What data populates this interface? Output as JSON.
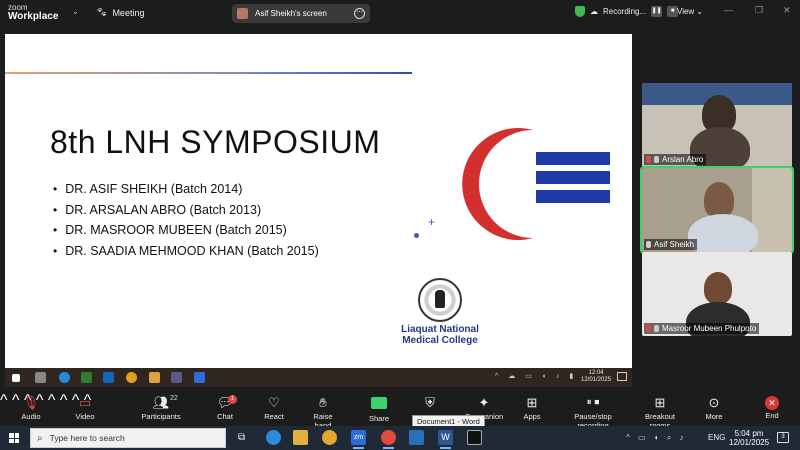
{
  "app": {
    "brand_small": "zoom",
    "brand_name": "Workplace",
    "meeting_label": "Meeting"
  },
  "share_pill": {
    "label": "Asif Sheikh's screen"
  },
  "recording": {
    "label": "Recording...",
    "pause": "❚❚",
    "stop": "■"
  },
  "view": {
    "label": "View"
  },
  "slide": {
    "title": "8th LNH SYMPOSIUM",
    "speakers": [
      "DR. ASIF SHEIKH (Batch 2014)",
      "DR. ARSALAN ABRO (Batch 2013)",
      "DR. MASROOR MUBEEN (Batch 2015)",
      "DR. SAADIA MEHMOOD KHAN (Batch 2015)"
    ],
    "college_line1": "Liaquat National",
    "college_line2": "Medical College",
    "logo_colors": {
      "crescent": "#d32f2f",
      "bars": "#1f3aa6"
    }
  },
  "inner_taskbar": {
    "time": "12:04",
    "date": "12/01/2025",
    "tray": "^ ☁ ▭ ◖ ♪ ▮"
  },
  "participants": [
    {
      "name": "Arslan Abro",
      "bg": "#c8c2b6"
    },
    {
      "name": "Asif Sheikh",
      "bg": "#a89f8f"
    },
    {
      "name": "Masroor Mubeen Phulpoto",
      "bg": "#e9e8e6"
    }
  ],
  "toolbar": {
    "audio": "Audio",
    "video": "Video",
    "participants": "Participants",
    "participants_count": "22",
    "chat": "Chat",
    "chat_badge": "1",
    "react": "React",
    "raise_hand": "Raise hand",
    "share": "Share",
    "companion": "Companion",
    "apps": "Apps",
    "pause_stop": "Pause/stop recording",
    "breakout": "Breakout rooms",
    "more": "More",
    "end": "End"
  },
  "tooltip": {
    "text": "Document1 - Word"
  },
  "taskbar": {
    "search_placeholder": "Type here to search",
    "language": "ENG",
    "time": "5:04 pm",
    "date": "12/01/2025",
    "notification_count": "3"
  }
}
